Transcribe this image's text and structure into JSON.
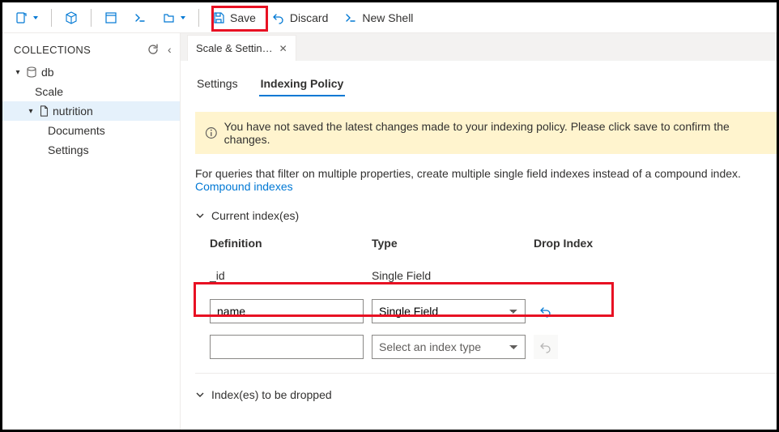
{
  "toolbar": {
    "save_label": "Save",
    "discard_label": "Discard",
    "newshell_label": "New Shell"
  },
  "sidebar": {
    "title": "COLLECTIONS",
    "db_label": "db",
    "scale_label": "Scale",
    "nutrition_label": "nutrition",
    "documents_label": "Documents",
    "settings_label": "Settings"
  },
  "tab": {
    "label": "Scale & Settin…"
  },
  "subtabs": {
    "settings": "Settings",
    "indexing": "Indexing Policy"
  },
  "banner": {
    "text": "You have not saved the latest changes made to your indexing policy. Please click save to confirm the changes."
  },
  "desc": {
    "text": "For queries that filter on multiple properties, create multiple single field indexes instead of a compound index. ",
    "link": "Compound indexes"
  },
  "sections": {
    "current": "Current index(es)",
    "dropped": "Index(es) to be dropped"
  },
  "grid": {
    "col_def": "Definition",
    "col_type": "Type",
    "col_drop": "Drop Index",
    "row0_def": "_id",
    "row0_type": "Single Field",
    "row1_def": "name",
    "row1_type": "Single Field",
    "row2_def": "",
    "row2_placeholder": "Select an index type"
  }
}
